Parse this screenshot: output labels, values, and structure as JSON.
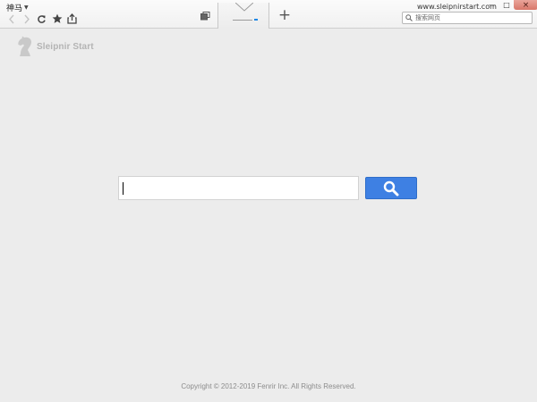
{
  "browser": {
    "app_menu_label": "神马",
    "url": "www.sleipnirstart.com",
    "top_search_placeholder": "搜索网页",
    "new_tab_label": "+",
    "window_controls": {
      "minimize": "—",
      "maximize": "□",
      "close": "×"
    }
  },
  "page": {
    "brand": "Sleipnir Start",
    "search_value": "",
    "footer": "Copyright © 2012-2019 Fenrir Inc. All Rights Reserved."
  },
  "colors": {
    "accent": "#3e80e3",
    "background": "#ececec",
    "close_button": "#d9776a"
  },
  "icons": {
    "back": "chevron-left-icon",
    "forward": "chevron-right-icon",
    "reload": "reload-icon",
    "bookmark": "star-icon",
    "share": "share-icon",
    "tab_stack": "stacked-tabs-icon",
    "brand_logo": "knight-icon",
    "search": "magnifier-icon"
  }
}
